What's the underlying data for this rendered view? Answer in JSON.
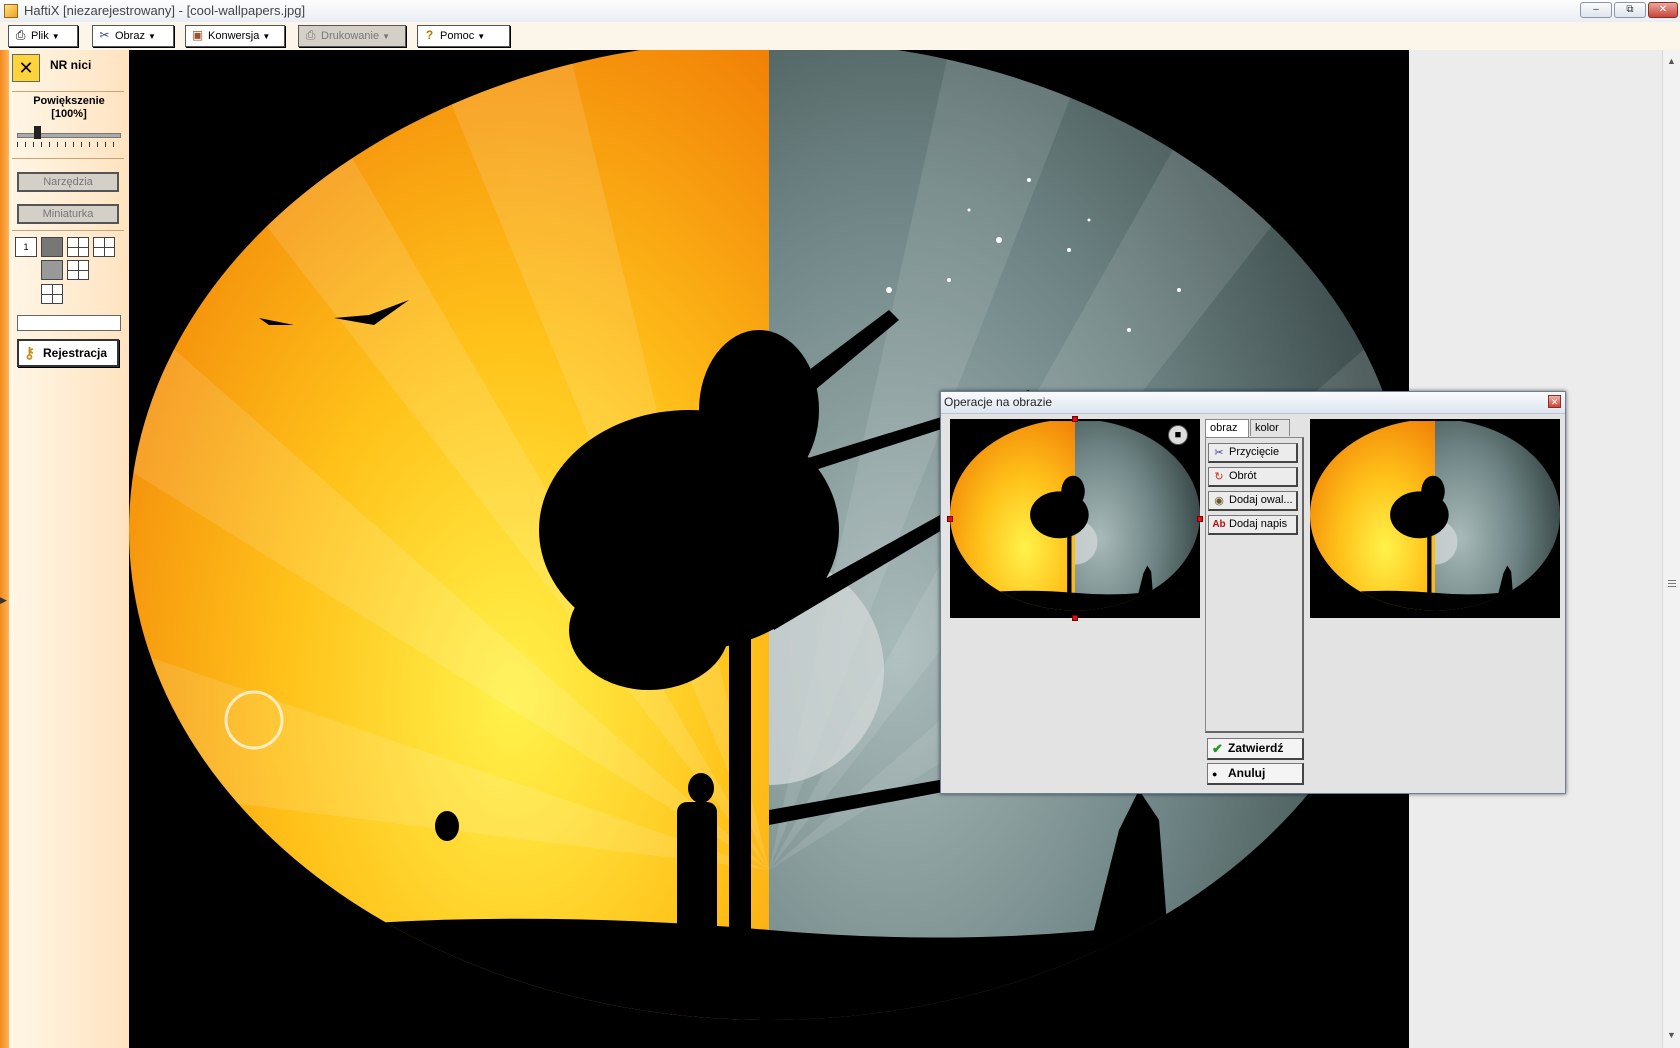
{
  "window": {
    "title": "HaftiX [niezarejestrowany] - [cool-wallpapers.jpg]",
    "controls": [
      "minimize",
      "restore",
      "close"
    ]
  },
  "menu": [
    {
      "label": "Plik",
      "icon": "printer-icon",
      "enabled": true
    },
    {
      "label": "Obraz",
      "icon": "scissors-icon",
      "enabled": true
    },
    {
      "label": "Konwersja",
      "icon": "palette-icon",
      "enabled": true
    },
    {
      "label": "Drukowanie",
      "icon": "printer-icon",
      "enabled": false
    },
    {
      "label": "Pomoc",
      "icon": "question-icon",
      "enabled": true
    }
  ],
  "left_panel": {
    "nr_label": "NR nici",
    "zoom_label": "Powiększenie",
    "zoom_value": "[100%]",
    "zoom_level": 0.2,
    "tools_button": "Narzędzia",
    "thumbnail_button": "Miniaturka",
    "layout_buttons": [
      "1",
      "2",
      "3",
      "4",
      "5",
      "6"
    ],
    "register_button": "Rejestracja"
  },
  "dialog": {
    "title": "Operacje na obrazie",
    "tabs": [
      {
        "label": "obraz",
        "active": true
      },
      {
        "label": "kolor",
        "active": false
      }
    ],
    "operations": [
      {
        "label": "Przycięcie",
        "icon": "scissors-icon"
      },
      {
        "label": "Obrót",
        "icon": "rotate-icon"
      },
      {
        "label": "Dodaj owal...",
        "icon": "oval-icon"
      },
      {
        "label": "Dodaj napis",
        "icon": "text-icon"
      }
    ],
    "confirm_button": "Zatwierdź",
    "cancel_button": "Anuluj"
  },
  "colors": {
    "accent_orange": "#f28b1a",
    "canvas_bg": "#000000",
    "sun_yellow": "#ffcf1a",
    "night_gray": "#6f8585"
  }
}
